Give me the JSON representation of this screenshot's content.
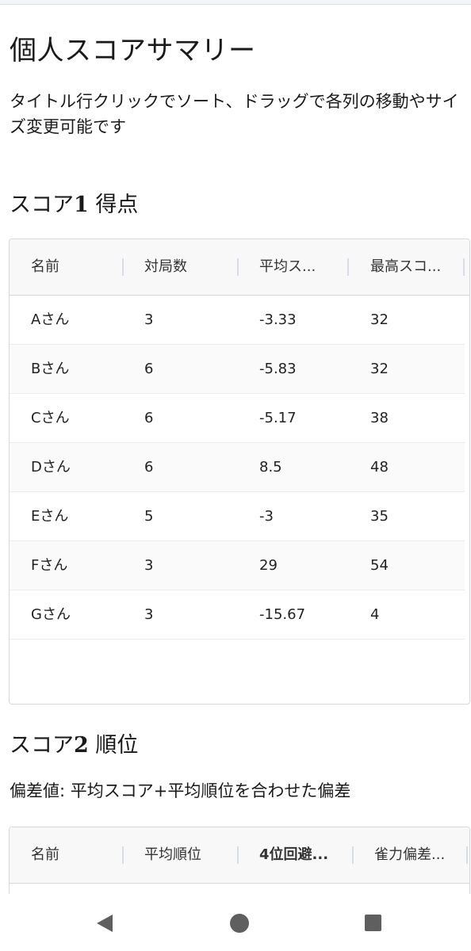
{
  "page": {
    "title": "個人スコアサマリー",
    "description": "タイトル行クリックでソート、ドラッグで各列の移動やサイズ変更可能です"
  },
  "score1": {
    "title_prefix": "スコア",
    "title_num": "1",
    "title_suffix": " 得点",
    "columns": [
      "名前",
      "対局数",
      "平均ス...",
      "最高スコ..."
    ],
    "rows": [
      [
        "Aさん",
        "3",
        "-3.33",
        "32"
      ],
      [
        "Bさん",
        "6",
        "-5.83",
        "32"
      ],
      [
        "Cさん",
        "6",
        "-5.17",
        "38"
      ],
      [
        "Dさん",
        "6",
        "8.5",
        "48"
      ],
      [
        "Eさん",
        "5",
        "-3",
        "35"
      ],
      [
        "Fさん",
        "3",
        "29",
        "54"
      ],
      [
        "Gさん",
        "3",
        "-15.67",
        "4"
      ]
    ]
  },
  "score2": {
    "title_prefix": "スコア",
    "title_num": "2",
    "title_suffix": " 順位",
    "note": "偏差値: 平均スコア+平均順位を合わせた偏差",
    "columns": [
      "名前",
      "平均順位",
      "4位回避...",
      "雀力偏差..."
    ]
  },
  "nav": {
    "icons": [
      "back-icon",
      "home-icon",
      "recent-apps-icon"
    ]
  }
}
